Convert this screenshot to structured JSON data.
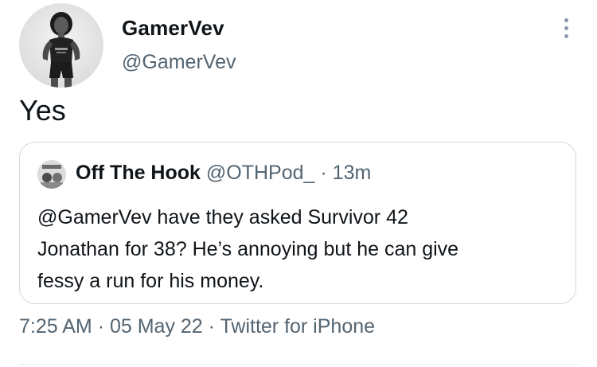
{
  "author": {
    "name": "GamerVev",
    "handle": "@GamerVev"
  },
  "tweet": {
    "text": "Yes"
  },
  "quote": {
    "name": "Off The Hook",
    "handle": "@OTHPod_",
    "separator": "·",
    "time": "13m",
    "lines": [
      "@GamerVev have they asked Survivor 42",
      "Jonathan for 38? He’s annoying but he can give",
      "fessy a run for his money."
    ]
  },
  "meta": {
    "time": "7:25 AM",
    "sep1": "·",
    "date": "05 May 22",
    "sep2": "·",
    "source": "Twitter for iPhone"
  },
  "icons": {
    "more": "more-vertical-icon"
  }
}
